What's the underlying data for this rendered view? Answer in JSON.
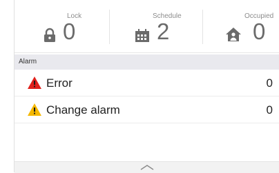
{
  "status": {
    "lock": {
      "label": "Lock",
      "value": "0",
      "icon": "lock-icon"
    },
    "schedule": {
      "label": "Schedule",
      "value": "2",
      "icon": "calendar-icon"
    },
    "occupied": {
      "label": "Occupied",
      "value": "0",
      "icon": "house-person-icon"
    }
  },
  "alarm": {
    "header": "Alarm",
    "rows": [
      {
        "label": "Error",
        "count": "0",
        "icon": "error-warning-icon",
        "color": "#e0201b"
      },
      {
        "label": "Change alarm",
        "count": "0",
        "icon": "caution-warning-icon",
        "color": "#f5b800"
      }
    ]
  },
  "colors": {
    "icon_gray": "#6b6b6b",
    "header_bg": "#e9e9ee"
  }
}
